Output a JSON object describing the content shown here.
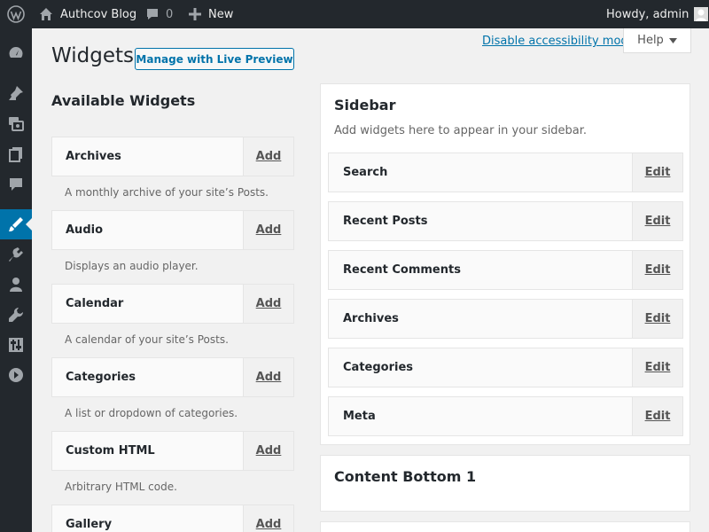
{
  "admin_bar": {
    "site_name": "Authcov Blog",
    "comments_count": "0",
    "new_label": "New",
    "greeting": "Howdy, admin"
  },
  "menu_icons": [
    "dashboard-icon",
    "posts-icon",
    "media-icon",
    "pages-icon",
    "comments-icon",
    "appearance-icon",
    "plugins-icon",
    "users-icon",
    "tools-icon",
    "settings-icon",
    "collapse-icon"
  ],
  "header": {
    "accessibility_link": "Disable accessibility mode",
    "help_label": "Help",
    "page_title": "Widgets",
    "live_preview_button": "Manage with Live Preview"
  },
  "available": {
    "title": "Available Widgets",
    "widgets": [
      {
        "name": "Archives",
        "action": "Add",
        "desc": "A monthly archive of your site’s Posts."
      },
      {
        "name": "Audio",
        "action": "Add",
        "desc": "Displays an audio player."
      },
      {
        "name": "Calendar",
        "action": "Add",
        "desc": "A calendar of your site’s Posts."
      },
      {
        "name": "Categories",
        "action": "Add",
        "desc": "A list or dropdown of categories."
      },
      {
        "name": "Custom HTML",
        "action": "Add",
        "desc": "Arbitrary HTML code."
      },
      {
        "name": "Gallery",
        "action": "Add",
        "desc": ""
      }
    ]
  },
  "sidebars": [
    {
      "title": "Sidebar",
      "desc": "Add widgets here to appear in your sidebar.",
      "widgets": [
        {
          "name": "Search",
          "action": "Edit"
        },
        {
          "name": "Recent Posts",
          "action": "Edit"
        },
        {
          "name": "Recent Comments",
          "action": "Edit"
        },
        {
          "name": "Archives",
          "action": "Edit"
        },
        {
          "name": "Categories",
          "action": "Edit"
        },
        {
          "name": "Meta",
          "action": "Edit"
        }
      ]
    },
    {
      "title": "Content Bottom 1",
      "desc": "",
      "widgets": []
    }
  ],
  "colors": {
    "admin_bar_bg": "#23282d",
    "accent": "#0073aa",
    "page_bg": "#f1f1f1"
  }
}
